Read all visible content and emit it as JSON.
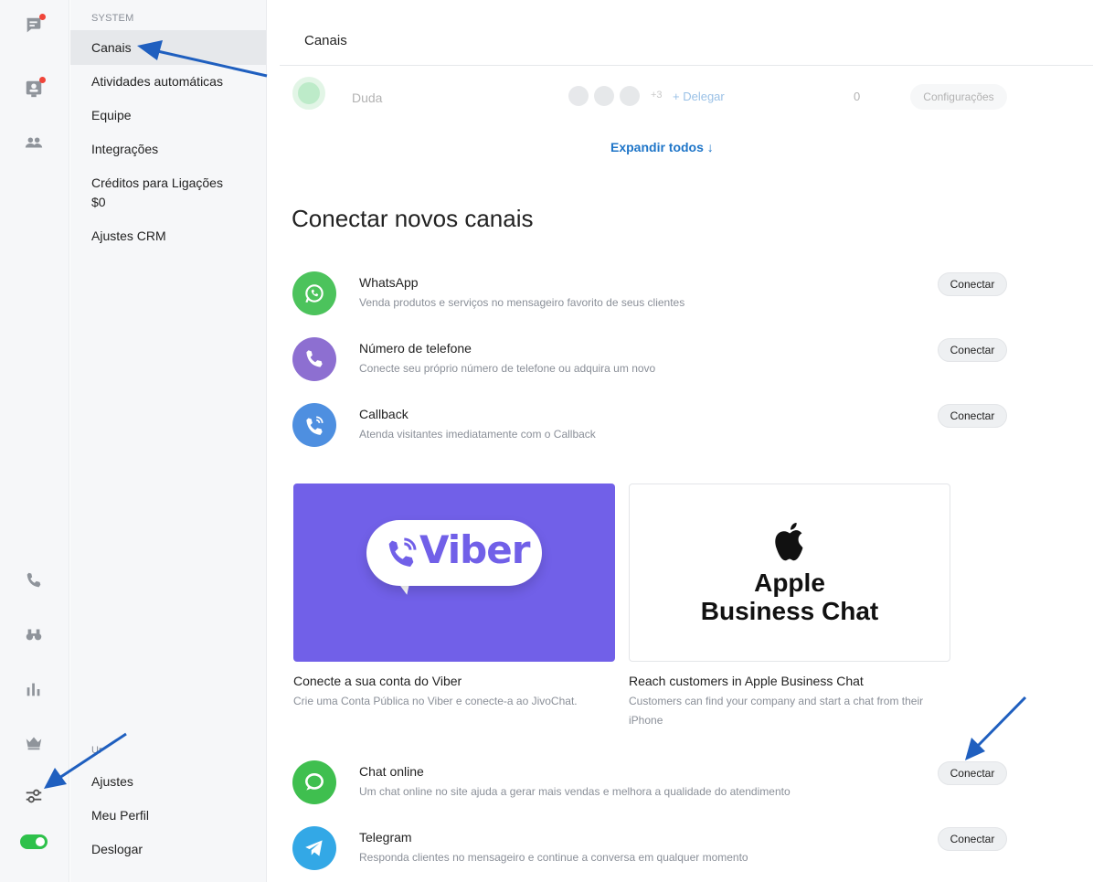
{
  "rail": {
    "icons": [
      "chat-icon",
      "contacts-icon",
      "team-icon",
      "phone-icon",
      "binoculars-icon",
      "chart-icon",
      "crown-icon",
      "settings-sliders-icon",
      "status-toggle-icon"
    ]
  },
  "menu": {
    "section_system": "SYSTEM",
    "items": [
      {
        "label": "Canais"
      },
      {
        "label": "Atividades automáticas"
      },
      {
        "label": "Equipe"
      },
      {
        "label": "Integrações"
      },
      {
        "label": "Créditos para Ligações"
      },
      {
        "label": "Ajustes CRM"
      }
    ],
    "credits_value": "$0",
    "section_user_partial": "Ur",
    "bottom_items": [
      {
        "label": "Ajustes"
      },
      {
        "label": "Meu Perfil"
      },
      {
        "label": "Deslogar"
      }
    ]
  },
  "header": {
    "title": "Canais"
  },
  "existing_channel": {
    "name": "Duda",
    "extra_count": "+3",
    "delegate_label": "+ Delegar",
    "count": "0",
    "config_label": "Configurações"
  },
  "expand_label": "Expandir todos ↓",
  "section_title": "Conectar novos canais",
  "channels_top": [
    {
      "title": "WhatsApp",
      "desc": "Venda produtos e serviços no mensageiro favorito de seus clientes",
      "button": "Conectar",
      "icon": "whatsapp-icon",
      "color": "#4cc35c"
    },
    {
      "title": "Número de telefone",
      "desc": "Conecte seu próprio número de telefone ou adquira um novo",
      "button": "Conectar",
      "icon": "phone-icon",
      "color": "#8d6fd1"
    },
    {
      "title": "Callback",
      "desc": "Atenda visitantes imediatamente com o Callback",
      "button": "Conectar",
      "icon": "callback-icon",
      "color": "#4e8fe0"
    }
  ],
  "cards": {
    "viber": {
      "logo_text": "Viber",
      "title": "Conecte a sua conta do Viber",
      "desc": "Crie uma Conta Pública no Viber e conecte-a ao JivoChat.",
      "color": "#7160e8"
    },
    "apple": {
      "logo_line1": "Apple",
      "logo_line2": "Business Chat",
      "title": "Reach customers in Apple Business Chat",
      "desc": "Customers can find your company and start a chat from their iPhone"
    }
  },
  "channels_bottom": [
    {
      "title": "Chat online",
      "desc": "Um chat online no site ajuda a gerar mais vendas e melhora a qualidade do atendimento",
      "button": "Conectar",
      "icon": "chat-bubble-icon",
      "color": "#3fbf4f"
    },
    {
      "title": "Telegram",
      "desc": "Responda clientes no mensageiro e continue a conversa em qualquer momento",
      "button": "Conectar",
      "icon": "telegram-icon",
      "color": "#33a8e6"
    }
  ],
  "colors": {
    "link": "#1e75c8",
    "annotation_arrow": "#1f5fbf",
    "toggle_on": "#2ec14b"
  }
}
